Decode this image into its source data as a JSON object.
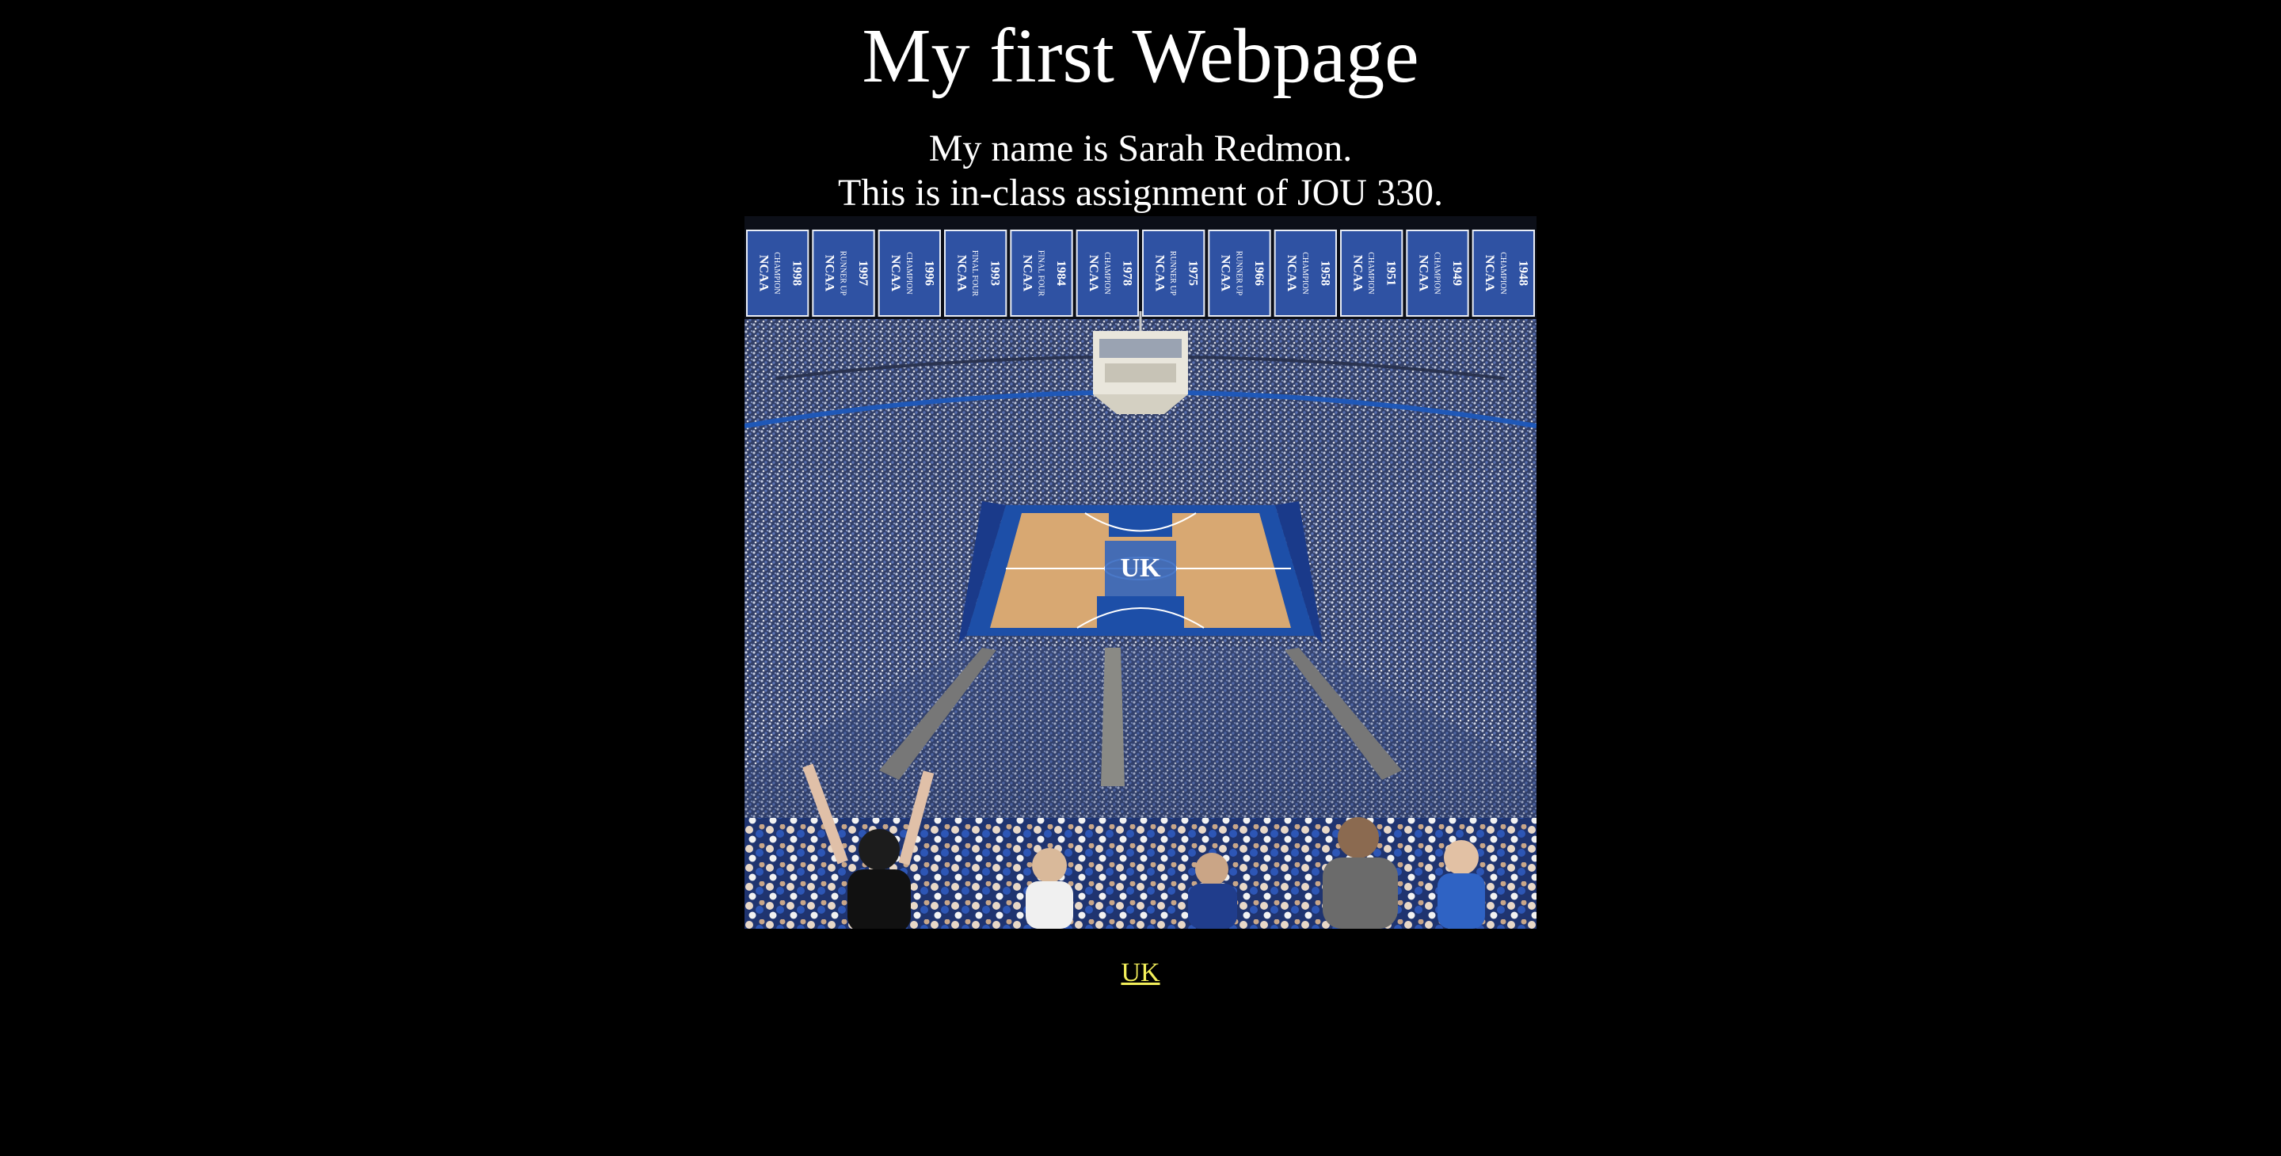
{
  "page": {
    "title": "My first Webpage",
    "intro_line_1": "My name is Sarah Redmon.",
    "intro_line_2": "This is in-class assignment of JOU 330."
  },
  "image": {
    "subject": "arena-photo",
    "banners": [
      {
        "org": "NCAA",
        "caption": "CHAMPION",
        "year": "1998"
      },
      {
        "org": "NCAA",
        "caption": "RUNNER UP",
        "year": "1997"
      },
      {
        "org": "NCAA",
        "caption": "CHAMPION",
        "year": "1996"
      },
      {
        "org": "NCAA",
        "caption": "FINAL FOUR",
        "year": "1993"
      },
      {
        "org": "NCAA",
        "caption": "FINAL FOUR",
        "year": "1984"
      },
      {
        "org": "NCAA",
        "caption": "CHAMPION",
        "year": "1978"
      },
      {
        "org": "NCAA",
        "caption": "RUNNER UP",
        "year": "1975"
      },
      {
        "org": "NCAA",
        "caption": "RUNNER UP",
        "year": "1966"
      },
      {
        "org": "NCAA",
        "caption": "CHAMPION",
        "year": "1958"
      },
      {
        "org": "NCAA",
        "caption": "CHAMPION",
        "year": "1951"
      },
      {
        "org": "NCAA",
        "caption": "CHAMPION",
        "year": "1949"
      },
      {
        "org": "NCAA",
        "caption": "CHAMPION",
        "year": "1948"
      }
    ]
  },
  "link": {
    "label": "UK"
  },
  "colors": {
    "background": "#000000",
    "text": "#ffffff",
    "link": "#f3ef5a",
    "banner_blue": "#2f52a3",
    "court_wood": "#d8a872",
    "court_blue": "#1d4fa8"
  }
}
